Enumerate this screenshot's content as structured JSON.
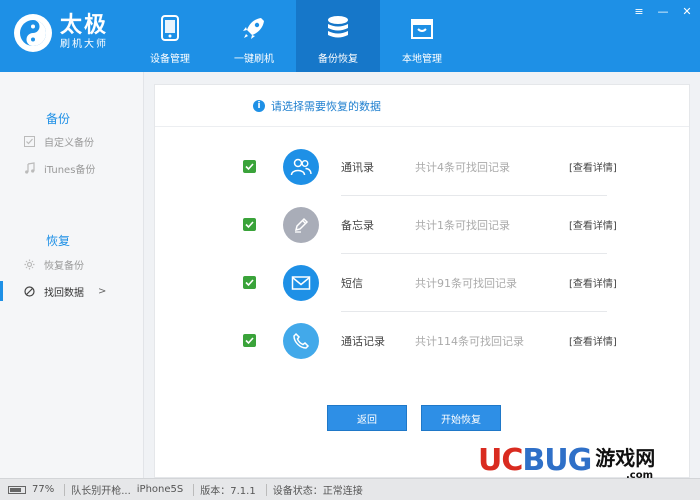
{
  "app": {
    "logo_title": "太极",
    "logo_sub": "刷机大师"
  },
  "nav": [
    {
      "label": "设备管理",
      "icon": "phone-icon"
    },
    {
      "label": "一键刷机",
      "icon": "rocket-icon"
    },
    {
      "label": "备份恢复",
      "icon": "database-icon",
      "active": true
    },
    {
      "label": "本地管理",
      "icon": "box-icon"
    }
  ],
  "window_controls": {
    "menu": "≡",
    "minimize": "—",
    "close": "✕"
  },
  "sidebar": {
    "backup_heading": "备份",
    "backup_items": [
      {
        "label": "自定义备份",
        "icon": "checkbox-icon"
      },
      {
        "label": "iTunes备份",
        "icon": "music-note-icon"
      }
    ],
    "restore_heading": "恢复",
    "restore_items": [
      {
        "label": "恢复备份",
        "icon": "gear-icon"
      },
      {
        "label": "找回数据",
        "icon": "no-entry-icon",
        "active": true,
        "chevron": ">"
      }
    ]
  },
  "main": {
    "notice": "请选择需要恢复的数据",
    "rows": [
      {
        "name": "通讯录",
        "count": "共计4条可找回记录",
        "link": "[查看详情]",
        "icon": "contacts-icon",
        "color": "#1e90e6",
        "checked": true
      },
      {
        "name": "备忘录",
        "count": "共计1条可找回记录",
        "link": "[查看详情]",
        "icon": "pencil-icon",
        "color": "#a9adb8",
        "checked": true
      },
      {
        "name": "短信",
        "count": "共计91条可找回记录",
        "link": "[查看详情]",
        "icon": "envelope-icon",
        "color": "#1e90e6",
        "checked": true
      },
      {
        "name": "通话记录",
        "count": "共计114条可找回记录",
        "link": "[查看详情]",
        "icon": "phone-call-icon",
        "color": "#42a9ea",
        "checked": true
      }
    ],
    "back_button": "返回",
    "start_button": "开始恢复"
  },
  "status": {
    "battery": "77%",
    "battery_level": 0.77,
    "device_name": "队长别开枪...",
    "model": "iPhone5S",
    "version": "版本：7.1.1",
    "device_status": "设备状态：正常连接"
  },
  "watermark": {
    "uc": "UC",
    "bug": "BUG",
    "cn": "游戏网",
    "com": ".com"
  },
  "colors": {
    "primary": "#1e90e6",
    "nav_active": "#1677c9",
    "check_green": "#3aa33a",
    "watermark_red": "#d92b20",
    "watermark_blue": "#2f70c8"
  }
}
